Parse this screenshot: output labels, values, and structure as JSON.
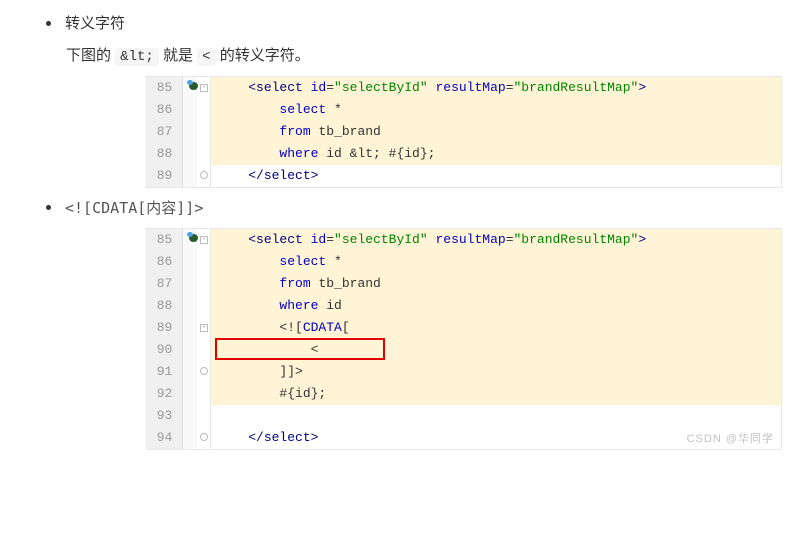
{
  "section1": {
    "title": "转义字符",
    "desc_pre": "下图的 ",
    "code_tok": "&lt;",
    "desc_mid": " 就是 ",
    "code_tok2": "<",
    "desc_post": " 的转义字符。"
  },
  "section2": {
    "title": "<![CDATA[内容]]>"
  },
  "code1": {
    "lines": [
      {
        "n": "85",
        "parts": [
          {
            "t": "    <",
            "c": "tag"
          },
          {
            "t": "select ",
            "c": "tag"
          },
          {
            "t": "id",
            "c": "attr"
          },
          {
            "t": "=",
            "c": "txt"
          },
          {
            "t": "\"selectById\" ",
            "c": "str"
          },
          {
            "t": "resultMap",
            "c": "attr"
          },
          {
            "t": "=",
            "c": "txt"
          },
          {
            "t": "\"brandResultMap\"",
            "c": "str"
          },
          {
            "t": ">",
            "c": "tag"
          }
        ],
        "hl": true,
        "fold": true,
        "bug": true
      },
      {
        "n": "86",
        "parts": [
          {
            "t": "        ",
            "c": "txt"
          },
          {
            "t": "select ",
            "c": "kw"
          },
          {
            "t": "*",
            "c": "txt"
          }
        ],
        "hl": true
      },
      {
        "n": "87",
        "parts": [
          {
            "t": "        ",
            "c": "txt"
          },
          {
            "t": "from ",
            "c": "kw"
          },
          {
            "t": "tb_brand",
            "c": "txt"
          }
        ],
        "hl": true
      },
      {
        "n": "88",
        "parts": [
          {
            "t": "        ",
            "c": "txt"
          },
          {
            "t": "where ",
            "c": "kw"
          },
          {
            "t": "id &lt; #{id};",
            "c": "txt"
          }
        ],
        "hl": true
      },
      {
        "n": "89",
        "parts": [
          {
            "t": "    </",
            "c": "tag"
          },
          {
            "t": "select",
            "c": "tag"
          },
          {
            "t": ">",
            "c": "tag"
          }
        ],
        "hl": false,
        "foldend": true
      }
    ]
  },
  "code2": {
    "lines": [
      {
        "n": "85",
        "parts": [
          {
            "t": "    <",
            "c": "tag"
          },
          {
            "t": "select ",
            "c": "tag"
          },
          {
            "t": "id",
            "c": "attr"
          },
          {
            "t": "=",
            "c": "txt"
          },
          {
            "t": "\"selectById\" ",
            "c": "str"
          },
          {
            "t": "resultMap",
            "c": "attr"
          },
          {
            "t": "=",
            "c": "txt"
          },
          {
            "t": "\"brandResultMap\"",
            "c": "str"
          },
          {
            "t": ">",
            "c": "tag"
          }
        ],
        "hl": true,
        "fold": true,
        "bug": true
      },
      {
        "n": "86",
        "parts": [
          {
            "t": "        ",
            "c": "txt"
          },
          {
            "t": "select ",
            "c": "kw"
          },
          {
            "t": "*",
            "c": "txt"
          }
        ],
        "hl": true
      },
      {
        "n": "87",
        "parts": [
          {
            "t": "        ",
            "c": "txt"
          },
          {
            "t": "from ",
            "c": "kw"
          },
          {
            "t": "tb_brand",
            "c": "txt"
          }
        ],
        "hl": true
      },
      {
        "n": "88",
        "parts": [
          {
            "t": "        ",
            "c": "txt"
          },
          {
            "t": "where ",
            "c": "kw"
          },
          {
            "t": "id",
            "c": "txt"
          }
        ],
        "hl": true
      },
      {
        "n": "89",
        "parts": [
          {
            "t": "        <![",
            "c": "txt"
          },
          {
            "t": "CDATA",
            "c": "kw"
          },
          {
            "t": "[",
            "c": "txt"
          }
        ],
        "hl": true,
        "fold": true
      },
      {
        "n": "90",
        "parts": [
          {
            "t": "            <",
            "c": "txt"
          }
        ],
        "hl": true,
        "redbox": true
      },
      {
        "n": "91",
        "parts": [
          {
            "t": "        ]]>",
            "c": "txt"
          }
        ],
        "hl": true,
        "foldend": true
      },
      {
        "n": "92",
        "parts": [
          {
            "t": "        #{id};",
            "c": "txt"
          }
        ],
        "hl": true
      },
      {
        "n": "93",
        "parts": [
          {
            "t": "",
            "c": "txt"
          }
        ],
        "hl": false
      },
      {
        "n": "94",
        "parts": [
          {
            "t": "    </",
            "c": "tag"
          },
          {
            "t": "select",
            "c": "tag"
          },
          {
            "t": ">",
            "c": "tag"
          }
        ],
        "hl": false,
        "foldend": true
      }
    ]
  },
  "watermark": "CSDN @华同学"
}
